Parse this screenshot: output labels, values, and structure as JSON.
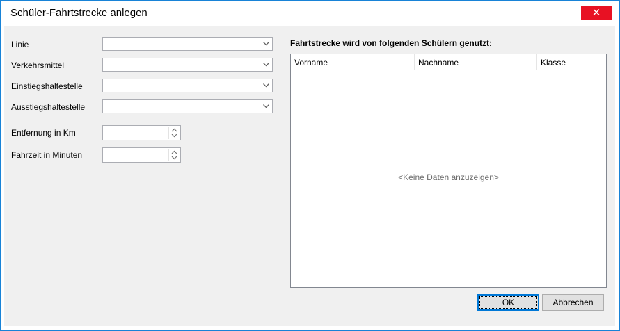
{
  "window": {
    "title": "Schüler-Fahrtstrecke anlegen",
    "close_glyph": "✕"
  },
  "form": {
    "linie_label": "Linie",
    "linie_value": "",
    "verkehrsmittel_label": "Verkehrsmittel",
    "verkehrsmittel_value": "",
    "einstieg_label": "Einstiegshaltestelle",
    "einstieg_value": "",
    "ausstieg_label": "Ausstiegshaltestelle",
    "ausstieg_value": "",
    "entfernung_label": "Entfernung in Km",
    "entfernung_value": "",
    "fahrzeit_label": "Fahrzeit in Minuten",
    "fahrzeit_value": ""
  },
  "students": {
    "heading": "Fahrtstrecke wird von folgenden Schülern genutzt:",
    "columns": [
      "Vorname",
      "Nachname",
      "Klasse"
    ],
    "rows": [],
    "empty_text": "<Keine Daten anzuzeigen>"
  },
  "buttons": {
    "ok": "OK",
    "cancel": "Abbrechen"
  },
  "colors": {
    "window_border": "#1883d7",
    "close_bg": "#e81123",
    "client_bg": "#f0f0f0",
    "default_button_border": "#0078d7"
  },
  "icons": {
    "close": "close-icon",
    "dropdown": "chevron-down-icon",
    "spin": "spin-arrows-icon"
  }
}
